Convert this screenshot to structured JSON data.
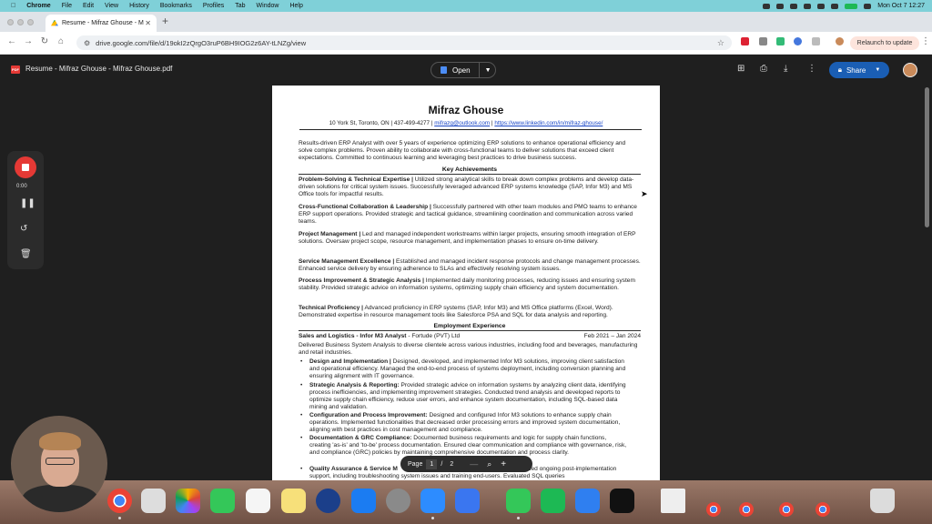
{
  "menubar": {
    "items": [
      "Chrome",
      "File",
      "Edit",
      "View",
      "History",
      "Bookmarks",
      "Profiles",
      "Tab",
      "Window",
      "Help"
    ],
    "clock": "Mon Oct 7  12:27"
  },
  "browser": {
    "tab_title": "Resume - Mifraz Ghouse - M",
    "url": "drive.google.com/file/d/19okI2zQrgO3ruP6BH9IOG2z6AY-tLNZg/view",
    "relaunch_label": "Relaunch to update"
  },
  "viewer": {
    "doc_title": "Resume - Mifraz Ghouse - Mifraz Ghouse.pdf",
    "pdf_badge": "PDF",
    "open_label": "Open",
    "share_label": "Share",
    "page_label": "Page",
    "page_current": "1",
    "page_sep": "/",
    "page_total": "2"
  },
  "recorder": {
    "time": "0:00"
  },
  "resume": {
    "name": "Mifraz Ghouse",
    "contact_plain": "10 York St, Toronto, ON  |  437-499-4277  |  ",
    "email": "mifrazg@outlook.com",
    "contact_sep": "  |  ",
    "linkedin": "https://www.linkedin.com/in/mifraz-ghouse/",
    "summary": "Results-driven ERP Analyst with over 5 years of experience optimizing ERP solutions to enhance operational efficiency and solve complex problems. Proven ability to collaborate with cross-functional teams to deliver solutions that exceed client expectations. Committed to continuous learning and leveraging best practices to drive business success.",
    "achievements_heading": "Key Achievements",
    "achievements": [
      {
        "title": "Problem-Solving & Technical Expertise |",
        "text": " Utilized strong analytical skills to break down complex problems and develop data-driven solutions for critical system issues. Successfully leveraged advanced ERP systems knowledge (SAP, Infor M3) and MS Office tools for impactful results."
      },
      {
        "title": "Cross-Functional Collaboration & Leadership |",
        "text": " Successfully partnered with other team modules and PMO teams to enhance ERP support operations. Provided strategic and tactical guidance, streamlining coordination and communication across varied teams."
      },
      {
        "title": "Project Management |",
        "text": " Led and managed independent workstreams within larger projects, ensuring smooth integration of ERP solutions. Oversaw project scope, resource management, and implementation phases to ensure on-time delivery."
      },
      {
        "title": "Service Management Excellence |",
        "text": " Established and managed incident response protocols and change management processes. Enhanced service delivery by ensuring adherence to SLAs and effectively resolving system issues."
      },
      {
        "title": "Process Improvement & Strategic Analysis |",
        "text": " Implemented daily monitoring processes, reducing issues and ensuring system stability. Provided strategic advice on information systems, optimizing supply chain efficiency and system documentation."
      },
      {
        "title": "Technical Proficiency |",
        "text": " Advanced proficiency in ERP systems (SAP, Infor M3) and MS Office platforms (Excel, Word). Demonstrated expertise in resource management tools like Salesforce PSA and SQL for data analysis and reporting."
      }
    ],
    "employment_heading": "Employment Experience",
    "job_title": "Sales and Logistics - Infor M3 Analyst",
    "job_company": "- Fortude (PVT) Ltd",
    "job_dates": "Feb 2021 – Jan 2024",
    "job_summary": "Delivered Business System Analysis to diverse clientele across various industries, including food and beverages, manufacturing and retail industries.",
    "bullets": [
      {
        "title": "Design and Implementation |",
        "text": " Designed, developed, and implemented Infor M3 solutions, improving client satisfaction and operational efficiency. Managed the end-to-end process of systems deployment, including conversion planning and ensuring alignment with IT governance."
      },
      {
        "title": "Strategic Analysis & Reporting:",
        "text": " Provided strategic advice on information systems by analyzing client data, identifying process inefficiencies, and implementing improvement strategies. Conducted trend analysis and developed reports to optimize supply chain efficiency, reduce user errors, and enhance system documentation, including SQL-based data mining and validation."
      },
      {
        "title": "Configuration and Process Improvement:",
        "text": " Designed and configured Infor M3 solutions to enhance supply chain operations. Implemented functionalities that decreased order processing errors and improved system documentation, aligning with best practices in cost management and compliance."
      },
      {
        "title": "Documentation & GRC Compliance:",
        "text": " Documented business requirements and logic for supply chain functions, creating 'as-is' and 'to-be' process documentation. Ensured clear communication and compliance with governance, risk, and compliance (GRC) policies by maintaining comprehensive documentation and process clarity."
      },
      {
        "title": "Quality Assurance & Service M",
        "text": "                                                  reviews and provided ongoing post-implementation support, including troubleshooting system issues and training end-users. Evaluated SQL queries"
      }
    ]
  },
  "colors": {
    "menubar": "#7fd0d8",
    "share": "#1a5eb4",
    "record": "#e53935",
    "link": "#1a47c7"
  }
}
